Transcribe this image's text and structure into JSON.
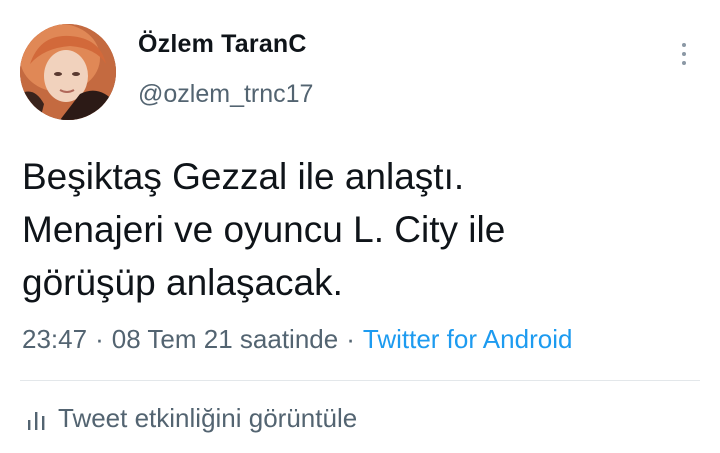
{
  "author": {
    "display_name": "Özlem TaranC",
    "handle": "@ozlem_trnc17",
    "avatar_icon": "profile-photo"
  },
  "tweet": {
    "lines": [
      "Beşiktaş Gezzal ile anlaştı.",
      "Menajeri ve oyuncu L. City ile",
      "görüşüp anlaşacak."
    ]
  },
  "meta": {
    "time": "23:47",
    "separator": "·",
    "date": "08 Tem 21 saatinde",
    "client": "Twitter for Android"
  },
  "actions": {
    "more_icon": "vertical-ellipsis-icon",
    "analytics_icon": "bar-chart-icon",
    "analytics_label": "Tweet etkinliğini görüntüle"
  },
  "colors": {
    "text_primary": "#0f1419",
    "text_secondary": "#536471",
    "link": "#1d9bf0",
    "divider": "#e3e7ea"
  }
}
